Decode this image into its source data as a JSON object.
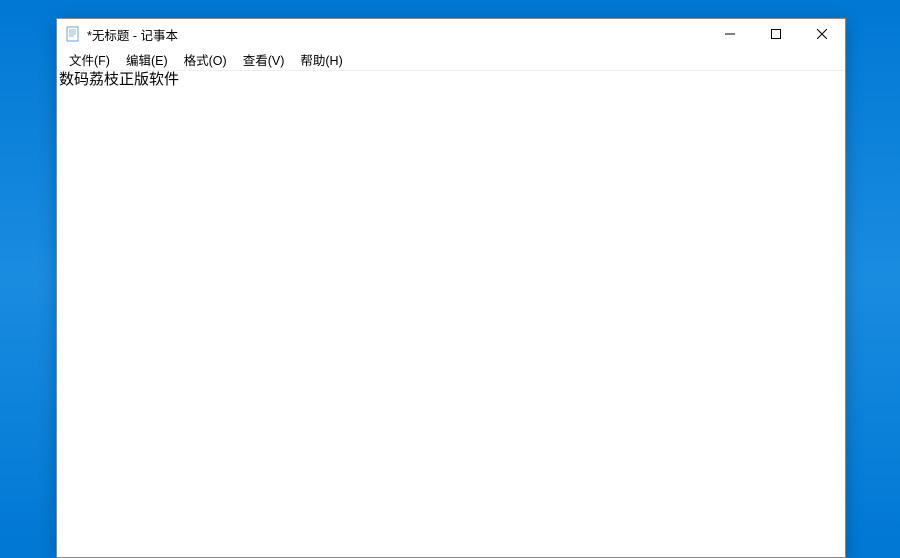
{
  "window": {
    "title": "*无标题 - 记事本"
  },
  "menu": {
    "file": "文件(F)",
    "edit": "编辑(E)",
    "format": "格式(O)",
    "view": "查看(V)",
    "help": "帮助(H)"
  },
  "editor": {
    "content": "数码荔枝正版软件"
  }
}
